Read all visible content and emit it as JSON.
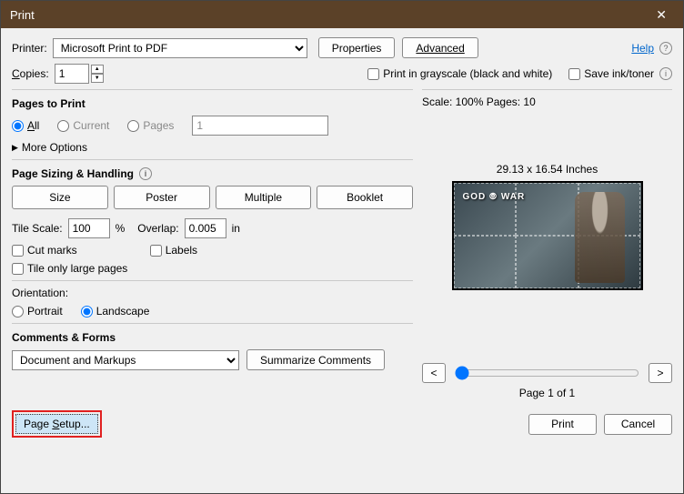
{
  "window": {
    "title": "Print",
    "close": "✕"
  },
  "top": {
    "printer_label": "Printer:",
    "printer_selected": "Microsoft Print to PDF",
    "properties": "Properties",
    "advanced": "Advanced",
    "help": "Help",
    "copies_label": "Copies:",
    "copies_value": "1",
    "grayscale": "Print in grayscale (black and white)",
    "save_ink": "Save ink/toner"
  },
  "pages": {
    "title": "Pages to Print",
    "all": "All",
    "current": "Current",
    "pages": "Pages",
    "pages_value": "1",
    "more_options": "More Options"
  },
  "sizing": {
    "title": "Page Sizing & Handling",
    "size": "Size",
    "poster": "Poster",
    "multiple": "Multiple",
    "booklet": "Booklet",
    "tile_scale_label": "Tile Scale:",
    "tile_scale_value": "100",
    "percent": "%",
    "overlap_label": "Overlap:",
    "overlap_value": "0.005",
    "overlap_unit": "in",
    "cut_marks": "Cut marks",
    "labels": "Labels",
    "tile_large": "Tile only large pages"
  },
  "orientation": {
    "title": "Orientation:",
    "portrait": "Portrait",
    "landscape": "Landscape"
  },
  "comments": {
    "title": "Comments & Forms",
    "selected": "Document and Markups",
    "summarize": "Summarize Comments"
  },
  "preview": {
    "scale_pages": "Scale: 100% Pages: 10",
    "dimensions": "29.13 x 16.54 Inches",
    "logo": "GOD ⦾ WAR",
    "prev": "<",
    "next": ">",
    "page_of": "Page 1 of 1"
  },
  "footer": {
    "page_setup": "Page Setup...",
    "print": "Print",
    "cancel": "Cancel"
  }
}
